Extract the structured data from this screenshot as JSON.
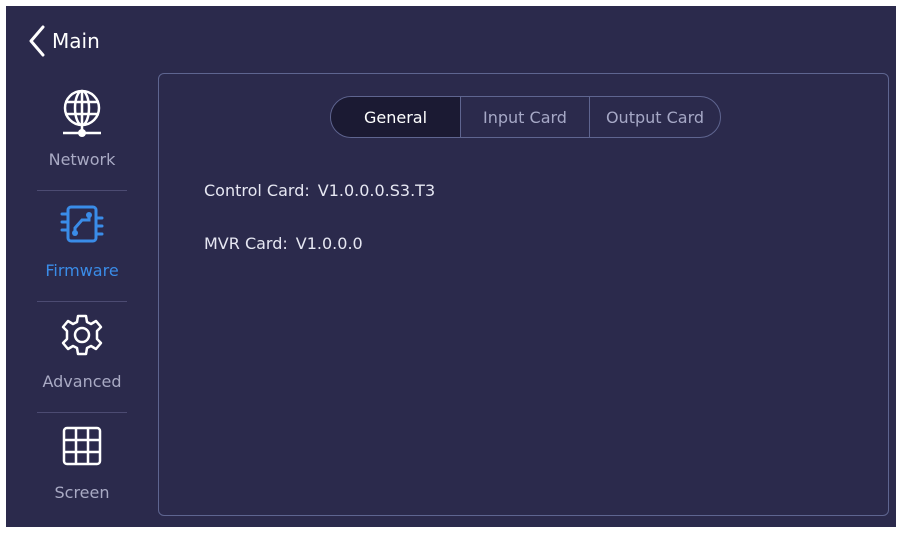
{
  "header": {
    "back_label": "Main",
    "back_icon": "chevron-left-icon"
  },
  "sidebar": {
    "items": [
      {
        "id": "network",
        "label": "Network",
        "icon": "globe-network-icon",
        "active": false
      },
      {
        "id": "firmware",
        "label": "Firmware",
        "icon": "circuit-board-icon",
        "active": true
      },
      {
        "id": "advanced",
        "label": "Advanced",
        "icon": "gear-icon",
        "active": false
      },
      {
        "id": "screen",
        "label": "Screen",
        "icon": "grid-icon",
        "active": false
      }
    ]
  },
  "main": {
    "tabs": [
      {
        "label": "General",
        "active": true
      },
      {
        "label": "Input Card",
        "active": false
      },
      {
        "label": "Output Card",
        "active": false
      }
    ],
    "info": [
      {
        "label": "Control Card:",
        "value": "V1.0.0.0.S3.T3"
      },
      {
        "label": "MVR Card:",
        "value": "V1.0.0.0"
      }
    ]
  },
  "colors": {
    "background": "#2b2a4c",
    "accent": "#3a8ce8",
    "text": "#ffffff",
    "muted_text": "#a9aac4",
    "border": "#5f6590"
  }
}
